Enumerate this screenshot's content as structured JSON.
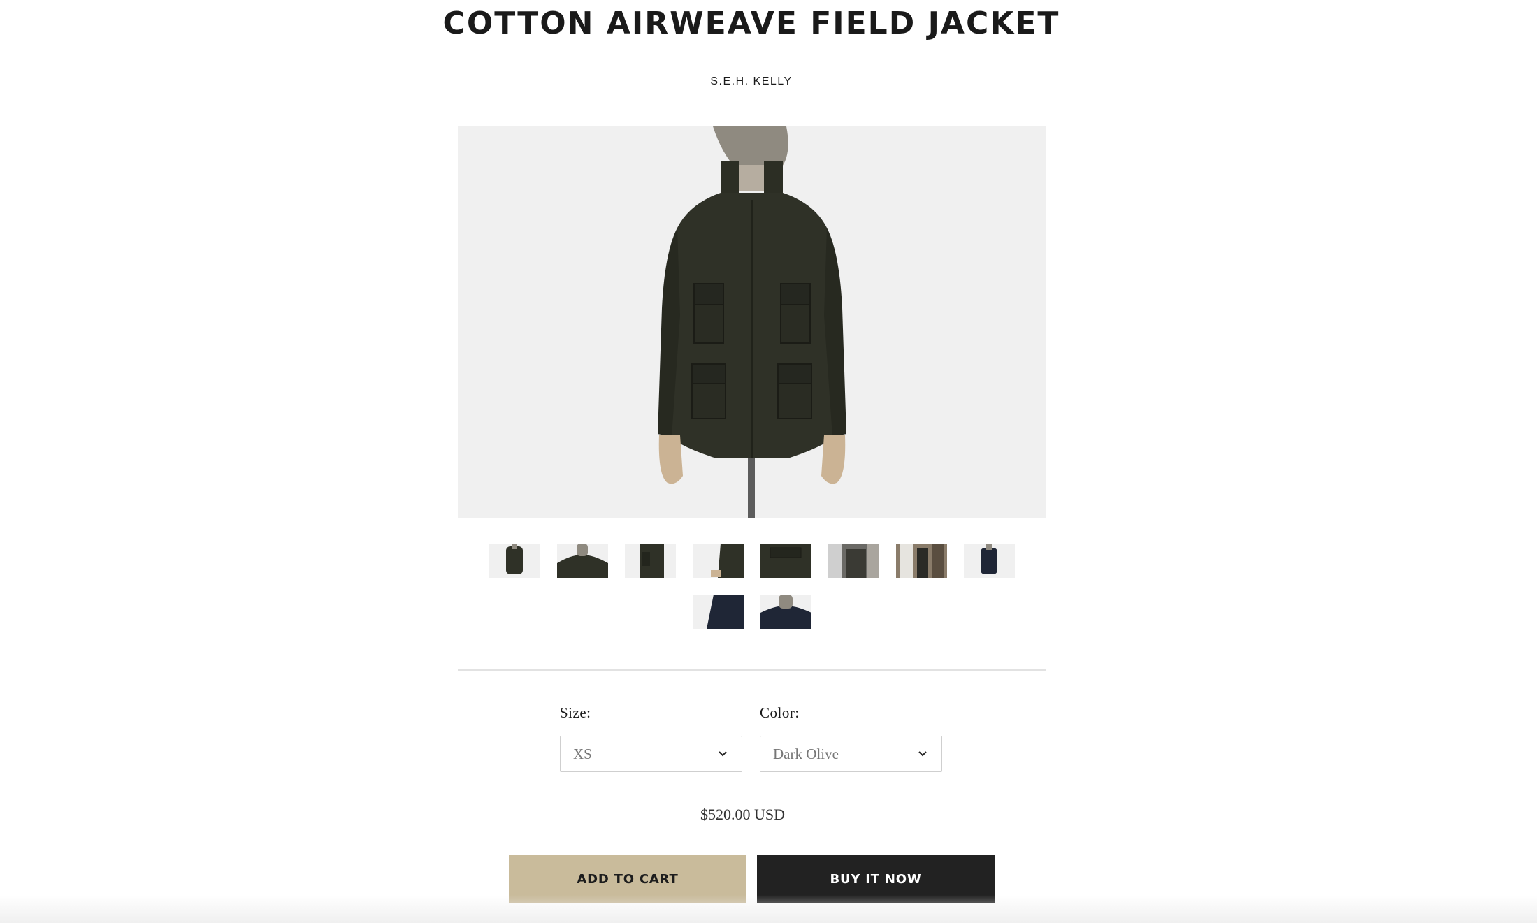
{
  "product": {
    "title": "COTTON AIRWEAVE FIELD JACKET",
    "vendor": "S.E.H. KELLY",
    "price": "$520.00 USD",
    "main_image_alt": "Dark olive cotton field jacket on mannequin"
  },
  "gallery": {
    "thumbnails": [
      {
        "alt": "jacket-front",
        "tone": "#2f3127"
      },
      {
        "alt": "collar-detail",
        "tone": "#2f3127"
      },
      {
        "alt": "side-pocket",
        "tone": "#2f3127"
      },
      {
        "alt": "cuff-detail",
        "tone": "#2f3127"
      },
      {
        "alt": "pocket-flap",
        "tone": "#2f3127"
      },
      {
        "alt": "worn-street",
        "tone": "#3a3a34"
      },
      {
        "alt": "worn-doorway",
        "tone": "#3a3a34"
      },
      {
        "alt": "navy-front",
        "tone": "#1f2636"
      },
      {
        "alt": "navy-side",
        "tone": "#1f2636"
      },
      {
        "alt": "navy-collar",
        "tone": "#1f2636"
      }
    ]
  },
  "options": {
    "size_label": "Size:",
    "size_value": "XS",
    "color_label": "Color:",
    "color_value": "Dark Olive"
  },
  "actions": {
    "add_to_cart": "ADD TO CART",
    "buy_now": "BUY IT NOW"
  },
  "colors": {
    "accent_gold": "#c9bb9b",
    "button_dark": "#222222",
    "jacket_olive": "#2f3127",
    "navy": "#1f2636"
  },
  "icons": {
    "select_chevron": "chevron-down-icon"
  }
}
